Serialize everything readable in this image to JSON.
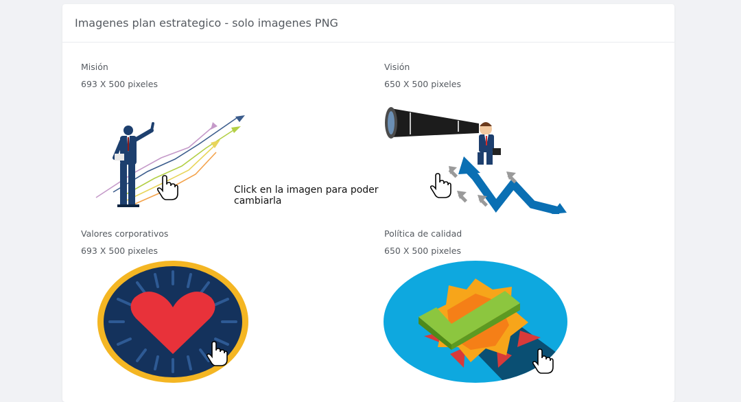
{
  "card": {
    "title": "Imagenes plan estrategico - solo imagenes PNG"
  },
  "items": [
    {
      "title": "Misión",
      "size": "693 X 500 pixeles"
    },
    {
      "title": "Visión",
      "size": "650 X 500 pixeles"
    },
    {
      "title": "Valores corporativos",
      "size": "693 X 500 pixeles"
    },
    {
      "title": "Política de calidad",
      "size": "650 X 500 pixeles"
    }
  ],
  "hint": "Click en la imagen para poder cambiarla",
  "colors": {
    "background": "#f1f2f5",
    "card": "#ffffff",
    "text": "#555a60",
    "navy": "#1d3f6e",
    "accent_blue": "#0a6fb3",
    "heart_red": "#e8323a",
    "gold": "#f4b623"
  },
  "icons": [
    "hand-pointer-icon"
  ]
}
